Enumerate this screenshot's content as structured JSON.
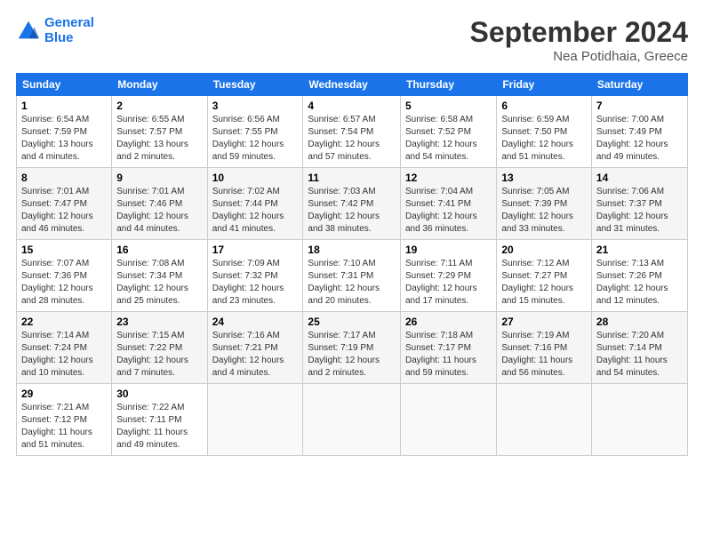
{
  "logo": {
    "line1": "General",
    "line2": "Blue"
  },
  "title": "September 2024",
  "location": "Nea Potidhaia, Greece",
  "days_header": [
    "Sunday",
    "Monday",
    "Tuesday",
    "Wednesday",
    "Thursday",
    "Friday",
    "Saturday"
  ],
  "weeks": [
    [
      {
        "day": "1",
        "info": "Sunrise: 6:54 AM\nSunset: 7:59 PM\nDaylight: 13 hours\nand 4 minutes."
      },
      {
        "day": "2",
        "info": "Sunrise: 6:55 AM\nSunset: 7:57 PM\nDaylight: 13 hours\nand 2 minutes."
      },
      {
        "day": "3",
        "info": "Sunrise: 6:56 AM\nSunset: 7:55 PM\nDaylight: 12 hours\nand 59 minutes."
      },
      {
        "day": "4",
        "info": "Sunrise: 6:57 AM\nSunset: 7:54 PM\nDaylight: 12 hours\nand 57 minutes."
      },
      {
        "day": "5",
        "info": "Sunrise: 6:58 AM\nSunset: 7:52 PM\nDaylight: 12 hours\nand 54 minutes."
      },
      {
        "day": "6",
        "info": "Sunrise: 6:59 AM\nSunset: 7:50 PM\nDaylight: 12 hours\nand 51 minutes."
      },
      {
        "day": "7",
        "info": "Sunrise: 7:00 AM\nSunset: 7:49 PM\nDaylight: 12 hours\nand 49 minutes."
      }
    ],
    [
      {
        "day": "8",
        "info": "Sunrise: 7:01 AM\nSunset: 7:47 PM\nDaylight: 12 hours\nand 46 minutes."
      },
      {
        "day": "9",
        "info": "Sunrise: 7:01 AM\nSunset: 7:46 PM\nDaylight: 12 hours\nand 44 minutes."
      },
      {
        "day": "10",
        "info": "Sunrise: 7:02 AM\nSunset: 7:44 PM\nDaylight: 12 hours\nand 41 minutes."
      },
      {
        "day": "11",
        "info": "Sunrise: 7:03 AM\nSunset: 7:42 PM\nDaylight: 12 hours\nand 38 minutes."
      },
      {
        "day": "12",
        "info": "Sunrise: 7:04 AM\nSunset: 7:41 PM\nDaylight: 12 hours\nand 36 minutes."
      },
      {
        "day": "13",
        "info": "Sunrise: 7:05 AM\nSunset: 7:39 PM\nDaylight: 12 hours\nand 33 minutes."
      },
      {
        "day": "14",
        "info": "Sunrise: 7:06 AM\nSunset: 7:37 PM\nDaylight: 12 hours\nand 31 minutes."
      }
    ],
    [
      {
        "day": "15",
        "info": "Sunrise: 7:07 AM\nSunset: 7:36 PM\nDaylight: 12 hours\nand 28 minutes."
      },
      {
        "day": "16",
        "info": "Sunrise: 7:08 AM\nSunset: 7:34 PM\nDaylight: 12 hours\nand 25 minutes."
      },
      {
        "day": "17",
        "info": "Sunrise: 7:09 AM\nSunset: 7:32 PM\nDaylight: 12 hours\nand 23 minutes."
      },
      {
        "day": "18",
        "info": "Sunrise: 7:10 AM\nSunset: 7:31 PM\nDaylight: 12 hours\nand 20 minutes."
      },
      {
        "day": "19",
        "info": "Sunrise: 7:11 AM\nSunset: 7:29 PM\nDaylight: 12 hours\nand 17 minutes."
      },
      {
        "day": "20",
        "info": "Sunrise: 7:12 AM\nSunset: 7:27 PM\nDaylight: 12 hours\nand 15 minutes."
      },
      {
        "day": "21",
        "info": "Sunrise: 7:13 AM\nSunset: 7:26 PM\nDaylight: 12 hours\nand 12 minutes."
      }
    ],
    [
      {
        "day": "22",
        "info": "Sunrise: 7:14 AM\nSunset: 7:24 PM\nDaylight: 12 hours\nand 10 minutes."
      },
      {
        "day": "23",
        "info": "Sunrise: 7:15 AM\nSunset: 7:22 PM\nDaylight: 12 hours\nand 7 minutes."
      },
      {
        "day": "24",
        "info": "Sunrise: 7:16 AM\nSunset: 7:21 PM\nDaylight: 12 hours\nand 4 minutes."
      },
      {
        "day": "25",
        "info": "Sunrise: 7:17 AM\nSunset: 7:19 PM\nDaylight: 12 hours\nand 2 minutes."
      },
      {
        "day": "26",
        "info": "Sunrise: 7:18 AM\nSunset: 7:17 PM\nDaylight: 11 hours\nand 59 minutes."
      },
      {
        "day": "27",
        "info": "Sunrise: 7:19 AM\nSunset: 7:16 PM\nDaylight: 11 hours\nand 56 minutes."
      },
      {
        "day": "28",
        "info": "Sunrise: 7:20 AM\nSunset: 7:14 PM\nDaylight: 11 hours\nand 54 minutes."
      }
    ],
    [
      {
        "day": "29",
        "info": "Sunrise: 7:21 AM\nSunset: 7:12 PM\nDaylight: 11 hours\nand 51 minutes."
      },
      {
        "day": "30",
        "info": "Sunrise: 7:22 AM\nSunset: 7:11 PM\nDaylight: 11 hours\nand 49 minutes."
      },
      {
        "day": "",
        "info": ""
      },
      {
        "day": "",
        "info": ""
      },
      {
        "day": "",
        "info": ""
      },
      {
        "day": "",
        "info": ""
      },
      {
        "day": "",
        "info": ""
      }
    ]
  ]
}
